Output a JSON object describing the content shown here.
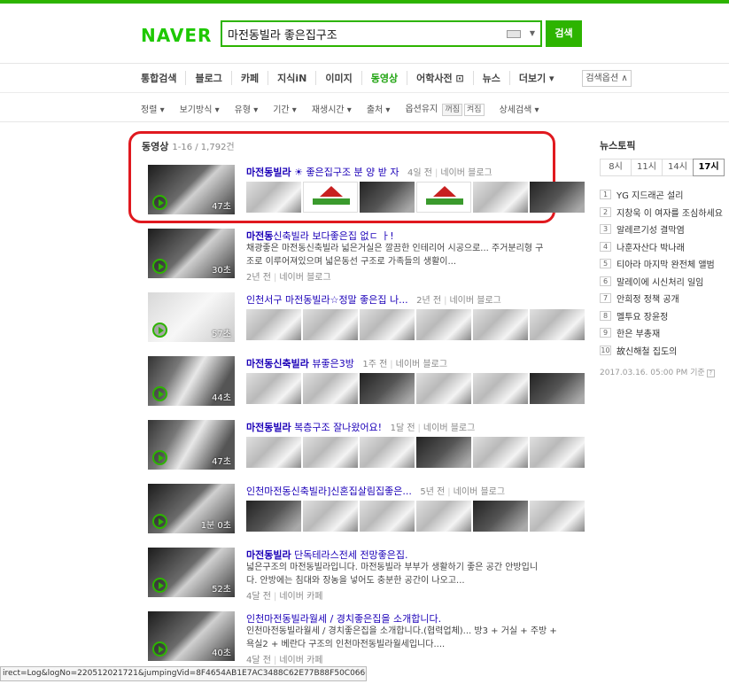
{
  "header": {
    "logo": "NAVER",
    "query": "마전동빌라 좋은집구조",
    "search_button": "검색"
  },
  "tabs": [
    {
      "label": "통합검색",
      "active": false
    },
    {
      "label": "블로그",
      "active": false
    },
    {
      "label": "카페",
      "active": false
    },
    {
      "label": "지식iN",
      "active": false
    },
    {
      "label": "이미지",
      "active": false
    },
    {
      "label": "동영상",
      "active": true
    },
    {
      "label": "어학사전 ⊡",
      "active": false
    },
    {
      "label": "뉴스",
      "active": false
    },
    {
      "label": "더보기 ▾",
      "active": false
    }
  ],
  "search_options": "검색옵션 ∧",
  "filters": {
    "sort": "정렬 ▾",
    "view": "보기방식 ▾",
    "type": "유형 ▾",
    "period": "기간 ▾",
    "playtime": "재생시간 ▾",
    "source": "출처 ▾",
    "keep_option": "옵션유지",
    "keep_on": "꺼짐",
    "keep_off": "켜짐",
    "detail": "상세검색 ▾"
  },
  "results": {
    "section_label": "동영상",
    "count": "1-16 / 1,792건",
    "items": [
      {
        "title_bold": "마전동빌라",
        "title_rest": " ☀ 좋은집구조 분 양 받 자",
        "age": "4일 전",
        "source": "네이버 블로그",
        "duration": "47초"
      },
      {
        "title_bold": "마전동",
        "title_rest": "신축빌라 보다좋은집 없ㄷ ㅏ!",
        "desc1": "채광좋은 마전동신축빌라 넓은거실은 깔끔한 인테리어 시공으로... 주거분리형 구",
        "desc2": "조로 이루어져있으며 넓은동선 구조로 가족들의 생활이...",
        "age": "2년 전",
        "source": "네이버 블로그",
        "duration": "30초"
      },
      {
        "title_bold": "인천서구 마전동빌라",
        "title_rest": "☆정말 좋은집 나...",
        "age": "2년 전",
        "source": "네이버 블로그",
        "duration": "57초"
      },
      {
        "title_bold": "마전동신축빌라",
        "title_rest": " 뷰좋은3방",
        "age": "1주 전",
        "source": "네이버 블로그",
        "duration": "44초"
      },
      {
        "title_bold": "마전동빌라",
        "title_rest": " 복층구조 잘나왔어요!",
        "age": "1달 전",
        "source": "네이버 블로그",
        "duration": "47초"
      },
      {
        "title_bold": "인천마전동신축빌라",
        "title_rest": "]신혼집살림집좋은...",
        "age": "5년 전",
        "source": "네이버 블로그",
        "duration": "1분 0초"
      },
      {
        "title_bold": "마전동빌라",
        "title_rest": " 단독테라스전세 전망좋은집.",
        "desc1": "넓은구조의 마전동빌라입니다. 마전동빌라 부부가 생활하기 좋은 공간 안방입니",
        "desc2": "다. 안방에는 침대와 장농을 넣어도 충분한 공간이 나오고...",
        "age": "4달 전",
        "source": "네이버 카페",
        "duration": "52초"
      },
      {
        "title_bold": "인천마전동빌라",
        "title_rest": "월세 / 경치좋은집을 소개합니다.",
        "desc1": "인천마전동빌라월세 / 경치좋은집을 소개합니다.(협력업체)... 방3 + 거실 + 주방 +",
        "desc2": "욕실2 + 베란다 구조의 인천마전동빌라월세입니다....",
        "age": "4달 전",
        "source": "네이버 카페",
        "duration": "40초"
      }
    ]
  },
  "sidebar": {
    "title": "뉴스토픽",
    "time_tabs": [
      "8시",
      "11시",
      "14시",
      "17시"
    ],
    "active_tab": "17시",
    "news": [
      {
        "rank": "1",
        "text": "YG 지드래곤 설리"
      },
      {
        "rank": "2",
        "text": "지창욱 이 여자를 조심하세요"
      },
      {
        "rank": "3",
        "text": "알레르기성 결막염"
      },
      {
        "rank": "4",
        "text": "나훈자산다 박나래"
      },
      {
        "rank": "5",
        "text": "티아라 마지막 완전체 앨범"
      },
      {
        "rank": "6",
        "text": "말레이에 시신처리 일임"
      },
      {
        "rank": "7",
        "text": "안희정 정책 공개"
      },
      {
        "rank": "8",
        "text": "멜투요 장윤정"
      },
      {
        "rank": "9",
        "text": "한은 부총재"
      },
      {
        "rank": "10",
        "text": "故신해철 집도의"
      }
    ],
    "timestamp": "2017.03.16. 05:00 PM 기준"
  },
  "status_bar": "irect=Log&logNo=220512021721&jumpingVid=8F4654AB1E7AC3488C62E77B88F50C066627",
  "colors": {
    "brand_green": "#2db400",
    "link_blue": "#1b00b8",
    "highlight_red": "#e0191f"
  }
}
